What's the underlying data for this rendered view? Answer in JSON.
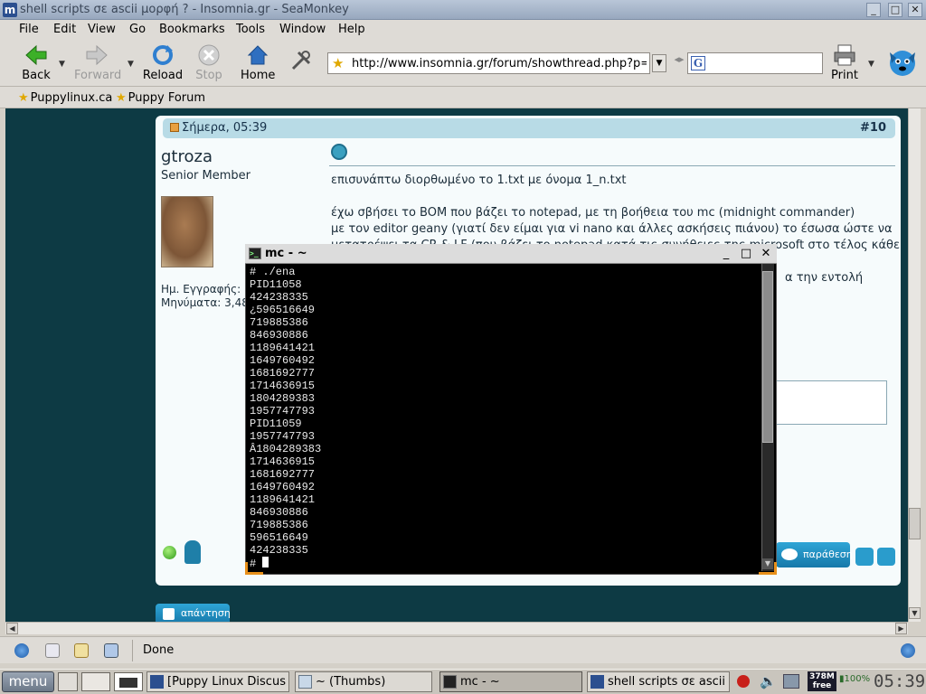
{
  "window": {
    "title": "shell scripts σε ascii μορφή ? - Insomnia.gr - SeaMonkey"
  },
  "menu": [
    "File",
    "Edit",
    "View",
    "Go",
    "Bookmarks",
    "Tools",
    "Window",
    "Help"
  ],
  "toolbar": {
    "back": "Back",
    "forward": "Forward",
    "reload": "Reload",
    "stop": "Stop",
    "home": "Home",
    "print": "Print",
    "url": "http://www.insomnia.gr/forum/showthread.php?p=325",
    "search_value": ""
  },
  "bookmarks": [
    "Puppylinux.ca",
    "Puppy Forum"
  ],
  "post": {
    "date": "Σήμερα, 05:39",
    "number": "#10",
    "username": "gtroza",
    "rank": "Senior Member",
    "joined": "Ημ. Εγγραφής: [",
    "posts": "Μηνύματα: 3,48",
    "lines": [
      "επισυνάπτω διορθωμένο το 1.txt με όνομα 1_n.txt",
      "έχω σβήσει το BOM που βάζει το notepad, με τη βοήθεια του mc (midnight commander)",
      "με τον editor geany (γιατί δεν είμαι για vi nano και άλλες ασκήσεις πιάνου) το έσωσα ώστε να",
      "μετατρέψει τα CR & LF (που βάζει το notepad κατά τις συνήθειες της microsoft στο τέλος κάθε",
      "α την εντολή"
    ],
    "quote_button": "παράθεση",
    "reply_button": "απάντηση"
  },
  "status": {
    "text": "Done"
  },
  "terminal": {
    "title": "mc - ~",
    "lines": [
      "# ./ena",
      "PID11058",
      "424238335",
      "¿596516649",
      "719885386",
      "846930886",
      "1189641421",
      "1649760492",
      "1681692777",
      "1714636915",
      "1804289383",
      "1957747793",
      "PID11059",
      "1957747793",
      "Â1804289383",
      "1714636915",
      "1681692777",
      "1649760492",
      "1189641421",
      "846930886",
      "719885386",
      "596516649",
      "424238335"
    ],
    "prompt": "# "
  },
  "taskbar": {
    "menu": "menu",
    "tasks": [
      "[Puppy Linux Discus",
      "~ (Thumbs)",
      "mc - ~",
      "shell scripts σε ascii"
    ],
    "memory_value": "378M",
    "memory_label": "free",
    "battery": "100%",
    "clock": "05:39"
  }
}
